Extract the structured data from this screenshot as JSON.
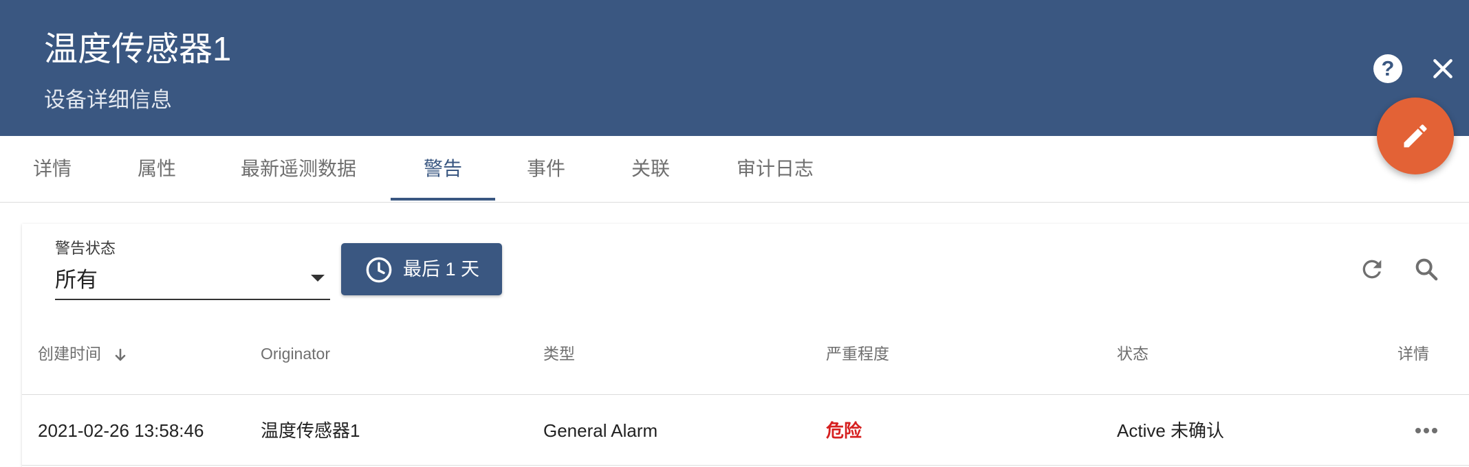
{
  "header": {
    "title": "温度传感器1",
    "subtitle": "设备详细信息",
    "help_icon": "help-circle-icon",
    "close_icon": "close-icon",
    "edit_icon": "pencil-icon",
    "background_color": "#3a5781",
    "fab_color": "#e36236"
  },
  "tabs": [
    {
      "label": "详情"
    },
    {
      "label": "属性"
    },
    {
      "label": "最新遥测数据"
    },
    {
      "label": "警告",
      "active": true
    },
    {
      "label": "事件"
    },
    {
      "label": "关联"
    },
    {
      "label": "审计日志"
    }
  ],
  "filter": {
    "status_label": "警告状态",
    "status_value": "所有",
    "time_button_label": "最后 1 天",
    "time_icon": "clock-icon",
    "refresh_icon": "refresh-icon",
    "search_icon": "search-icon"
  },
  "table": {
    "columns": [
      "创建时间",
      "Originator",
      "类型",
      "严重程度",
      "状态",
      "详情"
    ],
    "sort_icon": "arrow-down-icon",
    "rows": [
      {
        "created": "2021-02-26 13:58:46",
        "originator": "温度传感器1",
        "type": "General Alarm",
        "severity": "危险",
        "status": "Active 未确认",
        "details_icon": "more-horiz-icon"
      }
    ]
  },
  "colors": {
    "severity_critical": "#d62020",
    "primary": "#3a5781"
  }
}
